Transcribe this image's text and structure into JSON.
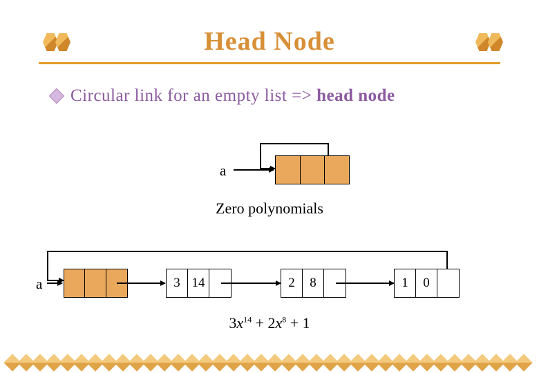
{
  "title": "Head Node",
  "bullet": {
    "text_prefix": "Circular link for an empty list => ",
    "strong": "head node"
  },
  "fig_top": {
    "label": "a",
    "caption": "Zero polynomials"
  },
  "fig_bot": {
    "label": "a",
    "nodes": [
      {
        "coef": "",
        "exp": "",
        "link": "",
        "is_head": true
      },
      {
        "coef": "3",
        "exp": "14",
        "link": ""
      },
      {
        "coef": "2",
        "exp": "8",
        "link": ""
      },
      {
        "coef": "1",
        "exp": "0",
        "link": ""
      }
    ],
    "caption_parts": {
      "t1": "3",
      "v1": "x",
      "e1": "14",
      "plus1": " + 2",
      "v2": "x",
      "e2": "8",
      "plus2": " + 1"
    }
  }
}
